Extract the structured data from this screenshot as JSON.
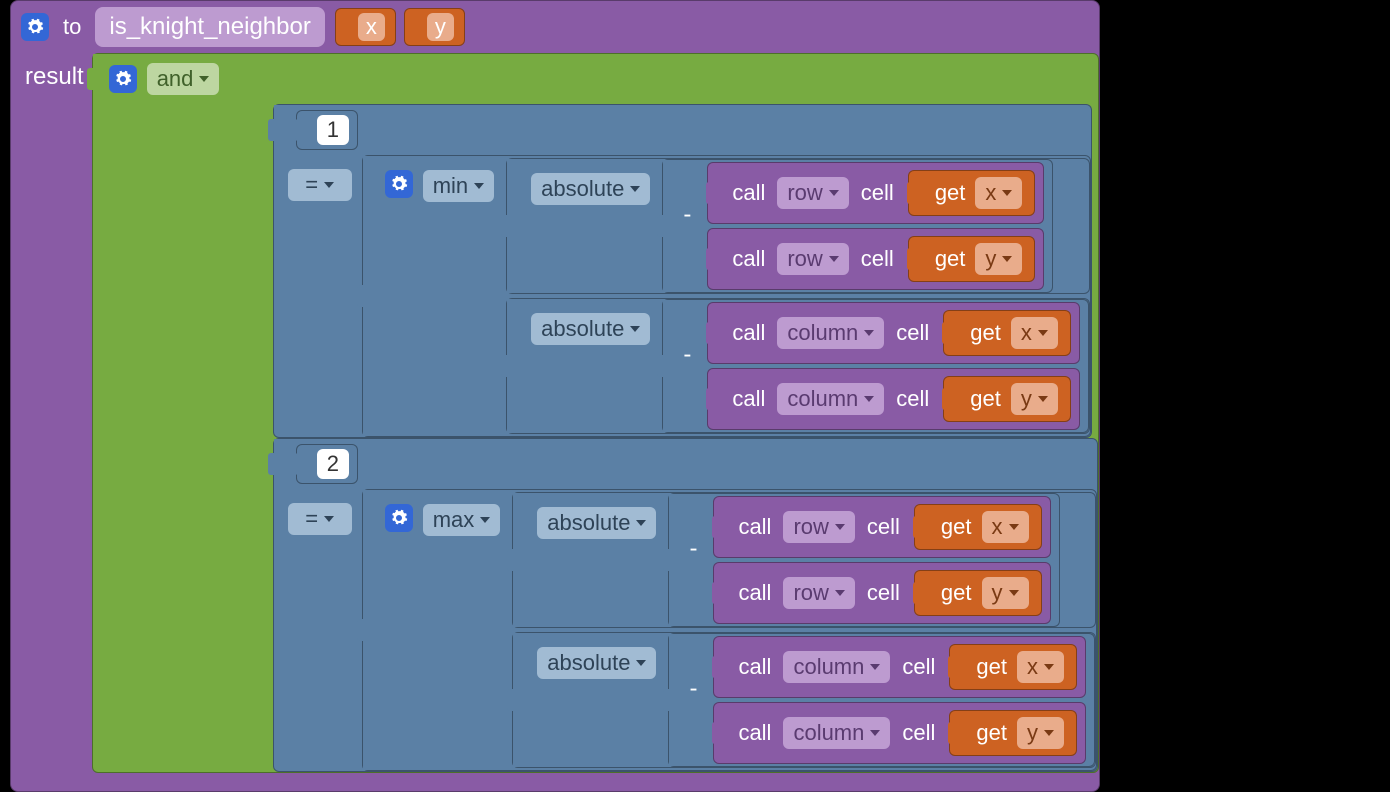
{
  "fn": {
    "to_label": "to",
    "name": "is_knight_neighbor",
    "params": [
      "x",
      "y"
    ],
    "result_label": "result"
  },
  "logic": {
    "op": "and"
  },
  "compare": {
    "op": "="
  },
  "constants": {
    "one": "1",
    "two": "2"
  },
  "agg": {
    "min": "min",
    "max": "max"
  },
  "unary": {
    "absolute": "absolute"
  },
  "arith": {
    "minus": "-"
  },
  "call": {
    "call_label": "call",
    "row": "row",
    "column": "column",
    "cell_label": "cell"
  },
  "var": {
    "get_label": "get",
    "x": "x",
    "y": "y"
  }
}
